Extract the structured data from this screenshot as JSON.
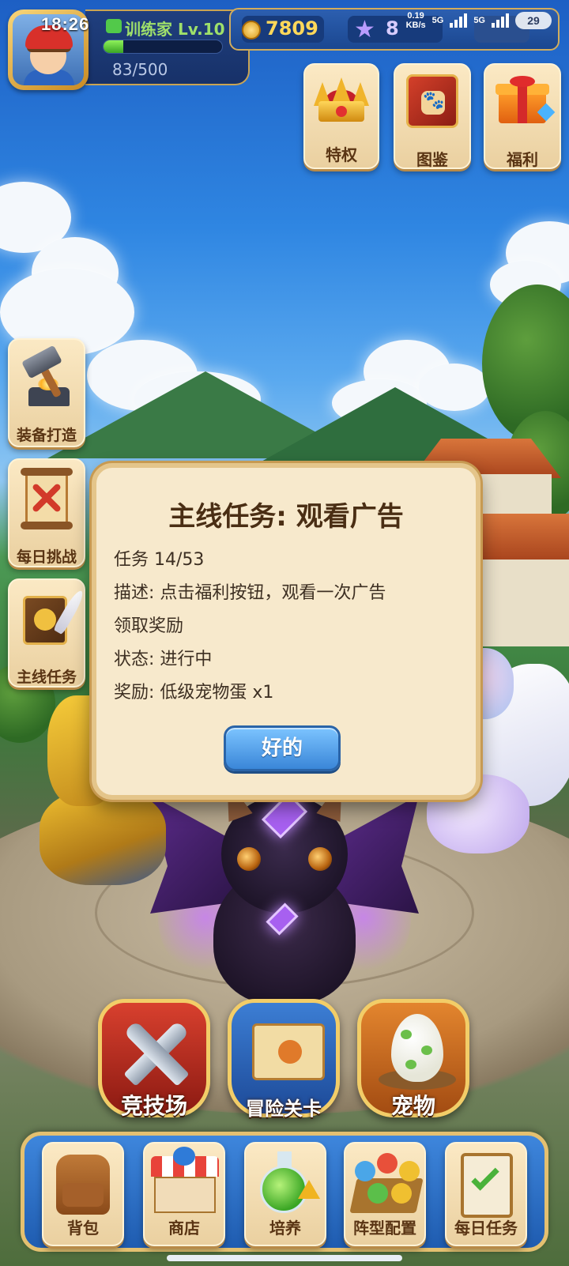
{
  "status_bar": {
    "time": "18:26",
    "net_speed": "0.19",
    "net_unit": "KB/s",
    "net_type_1": "5G",
    "net_type_2": "5G",
    "battery": "29"
  },
  "player": {
    "name": "训练家 Lv.10",
    "exp_text": "83/500",
    "exp_fraction": 0.166
  },
  "resources": {
    "coins": "7809",
    "gems": "8"
  },
  "top_tiles": [
    {
      "label": "特权",
      "icon": "crown-icon"
    },
    {
      "label": "图鉴",
      "icon": "book-icon"
    },
    {
      "label": "福利",
      "icon": "gift-icon"
    }
  ],
  "side_tiles": [
    {
      "label": "装备打造",
      "icon": "hammer-anvil-icon"
    },
    {
      "label": "每日挑战",
      "icon": "scroll-icon"
    },
    {
      "label": "主线任务",
      "icon": "quest-book-icon"
    }
  ],
  "dialog": {
    "title": "主线任务: 观看广告",
    "progress": "任务 14/53",
    "description": "描述: 点击福利按钮，观看一次广告",
    "description_cont": "领取奖励",
    "status": "状态: 进行中",
    "reward": "奖励: 低级宠物蛋 x1",
    "ok_label": "好的"
  },
  "main_buttons": [
    {
      "label": "竞技场",
      "icon": "crossed-swords-icon"
    },
    {
      "label": "冒险关卡",
      "icon": "map-scroll-icon"
    },
    {
      "label": "宠物",
      "icon": "egg-icon"
    }
  ],
  "bottom_nav": [
    {
      "label": "背包",
      "icon": "backpack-icon"
    },
    {
      "label": "商店",
      "icon": "shop-icon"
    },
    {
      "label": "培养",
      "icon": "potion-icon"
    },
    {
      "label": "阵型配置",
      "icon": "formation-icon"
    },
    {
      "label": "每日任务",
      "icon": "clipboard-icon"
    }
  ]
}
